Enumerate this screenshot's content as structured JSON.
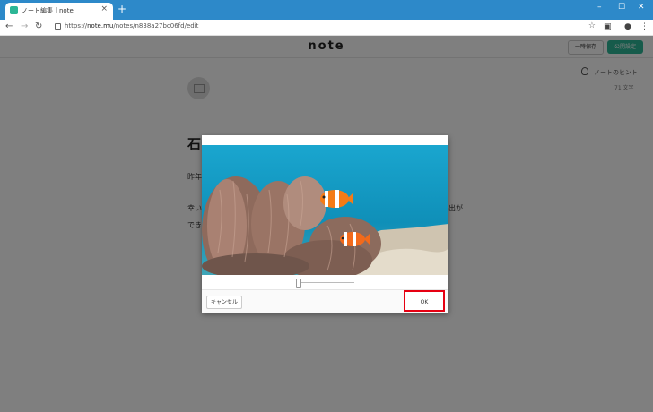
{
  "browser": {
    "tab_title": "ノート編集｜note",
    "tab_close": "×",
    "new_tab": "+",
    "url_prefix": "https://",
    "url_host": "note.mu",
    "url_path": "/notes/n838a27bc06fd/edit",
    "window_controls": [
      "–",
      "☐",
      "✕"
    ]
  },
  "note": {
    "logo": "note",
    "save_label": "一時保存",
    "publish_label": "公開設定",
    "hint_label": "ノートのヒント",
    "char_count": "71 文字",
    "title_partial": "石",
    "text_line1": "昨年",
    "text_line2": "幸い",
    "text_line3": "でき",
    "text_line2_end": "出が"
  },
  "modal": {
    "cancel_label": "キャンセル",
    "ok_label": "OK",
    "zoom_level": 0
  },
  "colors": {
    "accent": "#2cb696",
    "chrome_blue": "#2d89c9",
    "highlight": "#e60012"
  }
}
